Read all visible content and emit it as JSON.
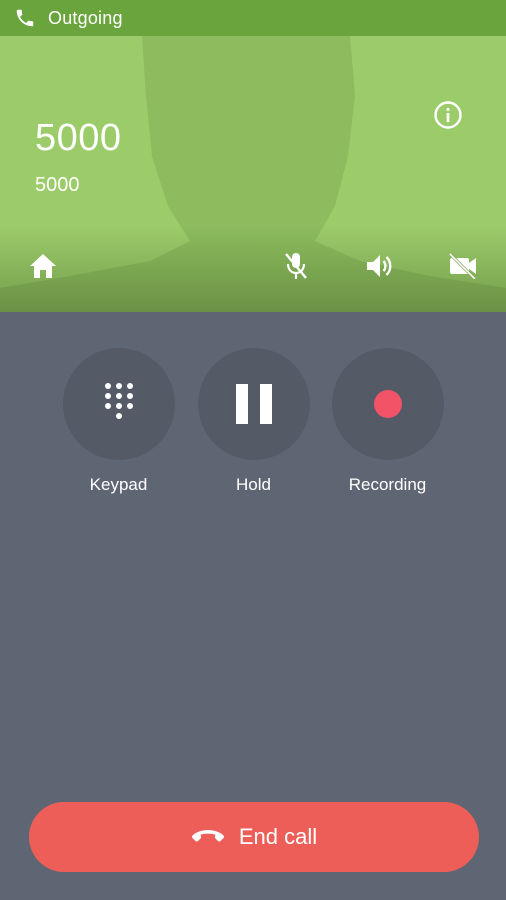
{
  "status_bar": {
    "icon": "phone-icon",
    "text": "Outgoing",
    "color": "#6aa43c"
  },
  "header": {
    "background": "#9ccb6a",
    "caller_name": "5000",
    "caller_number": "5000",
    "icons": [
      "info-icon",
      "home-icon",
      "mic-off-icon",
      "speaker-icon",
      "video-off-icon"
    ]
  },
  "controls": [
    {
      "label": "Keypad",
      "icon": "dialpad-icon"
    },
    {
      "label": "Hold",
      "icon": "pause-icon"
    },
    {
      "label": "Recording",
      "icon": "record-icon",
      "icon_color": "#f25366"
    }
  ],
  "end_call": {
    "label": "End call",
    "icon": "hang-up-icon",
    "color": "#ee5e58"
  }
}
